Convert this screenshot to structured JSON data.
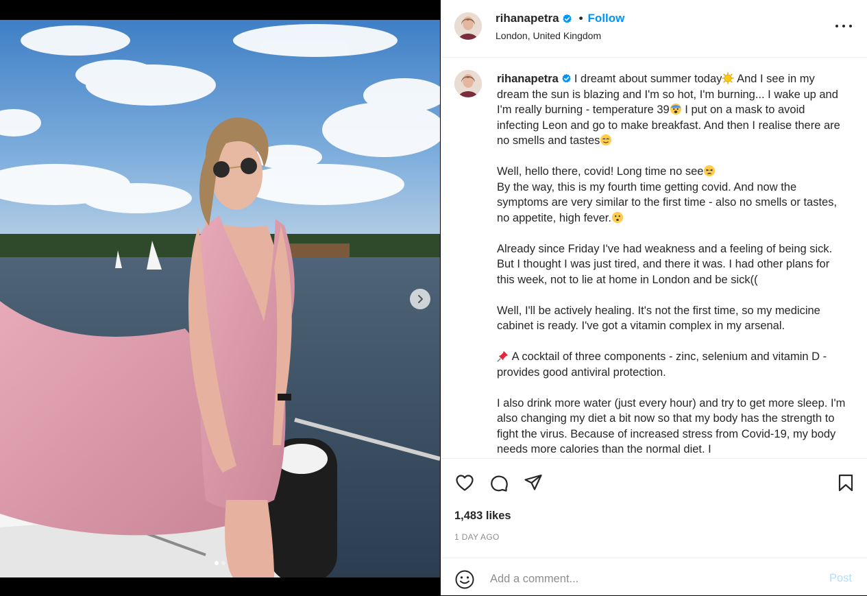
{
  "post": {
    "username": "rihanapetra",
    "verified": true,
    "separator": "•",
    "follow_label": "Follow",
    "location": "London, United Kingdom"
  },
  "caption": {
    "paragraphs": [
      "I dreamt about summer today",
      " And I see in my dream the sun is blazing and I'm so hot, I'm burning... I wake up and I'm really burning - temperature 39",
      " I put on a mask to avoid infecting Leon and go to make breakfast. And then I realise there are no smells and tastes",
      "Well, hello there, covid! Long time no see",
      "By the way, this is my fourth time getting covid. And now the symptoms are very similar to the first time - also no smells or tastes, no appetite, high fever.",
      "Already since Friday I've had weakness and a feeling of being sick. But I thought I was just tired, and there it was. I had other plans for this week, not to lie at home in London and be sick((",
      "Well, I'll be actively healing. It's not the first time, so my medicine cabinet is ready. I've got a vitamin complex in my arsenal.",
      " A cocktail of three components - zinc, selenium and vitamin D - provides good antiviral protection.",
      "I also drink more water (just every hour) and try to get more sleep. I'm also changing my diet a bit now so that my body has the strength to fight the virus. Because of increased stress from Covid-19, my body needs more calories than the normal diet. I"
    ]
  },
  "engagement": {
    "likes": "1,483 likes",
    "timestamp": "1 DAY AGO"
  },
  "comment": {
    "placeholder": "Add a comment...",
    "post_label": "Post"
  },
  "icons": {
    "like": "heart-icon",
    "comment": "comment-bubble-icon",
    "share": "paper-plane-icon",
    "save": "bookmark-icon",
    "emoji": "smiley-icon",
    "more": "more-options-icon",
    "next": "chevron-right-icon",
    "verified": "verified-badge-icon"
  },
  "colors": {
    "accent": "#0095f6",
    "post_disabled": "#b2dffc",
    "text": "#262626",
    "muted": "#8e8e8e"
  },
  "carousel": {
    "count": 2,
    "active_index": 0
  }
}
